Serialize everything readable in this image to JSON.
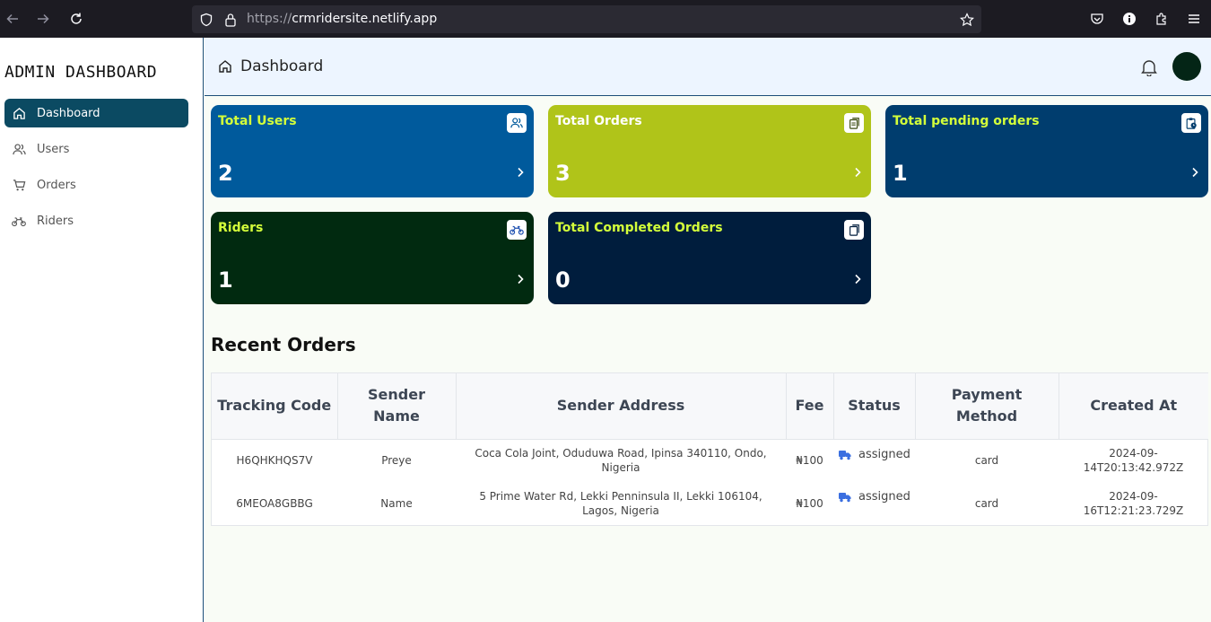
{
  "browser": {
    "url_protocol": "https://",
    "url_host": "crmridersite.netlify.app"
  },
  "sidebar": {
    "brand": "ADMIN DASHBOARD",
    "items": [
      {
        "label": "Dashboard",
        "icon": "home-icon",
        "active": true
      },
      {
        "label": "Users",
        "icon": "users-icon",
        "active": false
      },
      {
        "label": "Orders",
        "icon": "cart-icon",
        "active": false
      },
      {
        "label": "Riders",
        "icon": "bike-icon",
        "active": false
      }
    ]
  },
  "header": {
    "title": "Dashboard"
  },
  "cards": [
    {
      "title": "Total Users",
      "value": "2",
      "icon": "users-icon",
      "bg": "#005a9c",
      "title_color": "#d4ff3a"
    },
    {
      "title": "Total Orders",
      "value": "3",
      "icon": "clipboard-icon",
      "bg": "#b0c419",
      "title_color": "#ffffff"
    },
    {
      "title": "Total pending orders",
      "value": "1",
      "icon": "clipboard-clock-icon",
      "bg": "#003d6e",
      "title_color": "#d4ff3a"
    },
    {
      "title": "Riders",
      "value": "1",
      "icon": "bike-icon",
      "bg": "#012a10",
      "title_color": "#d4ff3a"
    },
    {
      "title": "Total Completed Orders",
      "value": "0",
      "icon": "copy-icon",
      "bg": "#001d3d",
      "title_color": "#d4ff3a"
    }
  ],
  "recent_orders": {
    "title": "Recent Orders",
    "columns": [
      "Tracking Code",
      "Sender Name",
      "Sender Address",
      "Fee",
      "Status",
      "Payment Method",
      "Created At"
    ],
    "rows": [
      {
        "tracking_code": "H6QHKHQS7V",
        "sender_name": "Preye",
        "sender_address": "Coca Cola Joint, Oduduwa Road, Ipinsa 340110, Ondo, Nigeria",
        "fee": "₦100",
        "status": "assigned",
        "payment_method": "card",
        "created_at": "2024-09-14T20:13:42.972Z"
      },
      {
        "tracking_code": "6MEOA8GBBG",
        "sender_name": "Name",
        "sender_address": "5 Prime Water Rd, Lekki Penninsula II, Lekki 106104, Lagos, Nigeria",
        "fee": "₦100",
        "status": "assigned",
        "payment_method": "card",
        "created_at": "2024-09-16T12:21:23.729Z"
      }
    ]
  },
  "colors": {
    "sidebar_active": "#0b4a62",
    "header_bg": "#edf5ff",
    "status_icon": "#3b6fe0"
  }
}
